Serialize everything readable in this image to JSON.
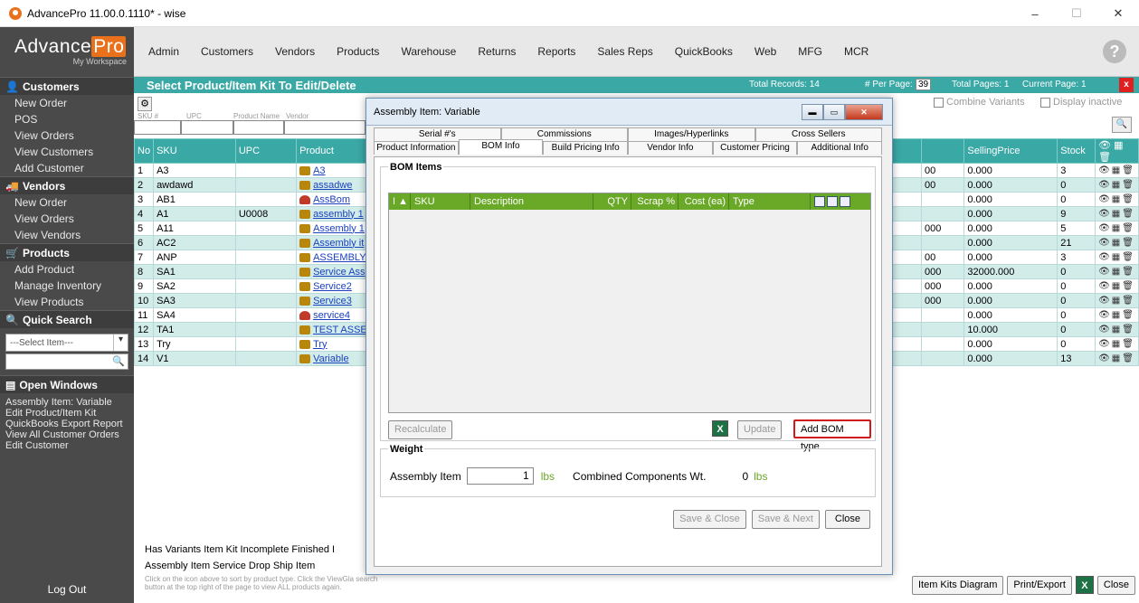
{
  "window": {
    "title": "AdvancePro 11.00.0.1110* - wise",
    "minimize": "–",
    "maximize": "☐",
    "close": "✕"
  },
  "logo": {
    "advance": "Advance",
    "pro": "Pro",
    "sub": "My Workspace"
  },
  "menu": [
    "Admin",
    "Customers",
    "Vendors",
    "Products",
    "Warehouse",
    "Returns",
    "Reports",
    "Sales Reps",
    "QuickBooks",
    "Web",
    "MFG",
    "MCR"
  ],
  "help": "?",
  "sidebar": {
    "customers": {
      "title": "Customers",
      "items": [
        "New Order",
        "POS",
        "View Orders",
        "View Customers",
        "Add Customer"
      ]
    },
    "vendors": {
      "title": "Vendors",
      "items": [
        "New Order",
        "View Orders",
        "View Vendors"
      ]
    },
    "products": {
      "title": "Products",
      "items": [
        "Add Product",
        "Manage Inventory",
        "View Products"
      ]
    },
    "quick_search": {
      "title": "Quick Search",
      "select": "---Select Item---"
    },
    "open_windows": {
      "title": "Open Windows",
      "items": [
        "Assembly Item: Variable",
        "Edit Product/Item Kit",
        "QuickBooks Export Report",
        "View All Customer Orders",
        "Edit Customer"
      ]
    },
    "logout": "Log Out"
  },
  "main": {
    "title": "Select Product/Item Kit To Edit/Delete",
    "total_records": "Total Records: 14",
    "per_page_label": "# Per Page:",
    "per_page": "39",
    "total_pages": "Total Pages: 1",
    "current_page": "Current Page: 1",
    "close": "x",
    "filters": {
      "sku": "SKU #",
      "upc": "UPC",
      "name": "Product Name",
      "vendor": "Vendor"
    },
    "combine_variants": "Combine Variants",
    "display_inactive": "Display inactive",
    "columns": [
      "No",
      "SKU",
      "UPC",
      "Product",
      "SellingPrice",
      "Stock"
    ],
    "rows": [
      {
        "no": "1",
        "sku": "A3",
        "upc": "",
        "product": "A3",
        "c": "00",
        "price": "0.000",
        "stock": "3",
        "type": "assembly"
      },
      {
        "no": "2",
        "sku": "awdawd",
        "upc": "",
        "product": "assadwe",
        "c": "00",
        "price": "0.000",
        "stock": "0",
        "type": "assembly"
      },
      {
        "no": "3",
        "sku": "AB1",
        "upc": "",
        "product": "AssBom",
        "c": "",
        "price": "0.000",
        "stock": "0",
        "type": "incomplete"
      },
      {
        "no": "4",
        "sku": "A1",
        "upc": "U0008",
        "product": "assembly 1",
        "c": "",
        "price": "0.000",
        "stock": "9",
        "type": "assembly"
      },
      {
        "no": "5",
        "sku": "A11",
        "upc": "",
        "product": "Assembly 1",
        "c": "000",
        "price": "0.000",
        "stock": "5",
        "type": "assembly"
      },
      {
        "no": "6",
        "sku": "AC2",
        "upc": "",
        "product": "Assembly it",
        "c": "",
        "price": "0.000",
        "stock": "21",
        "type": "assembly"
      },
      {
        "no": "7",
        "sku": "ANP",
        "upc": "",
        "product": "ASSEMBLY",
        "c": "00",
        "price": "0.000",
        "stock": "3",
        "type": "assembly"
      },
      {
        "no": "8",
        "sku": "SA1",
        "upc": "",
        "product": "Service Ass",
        "c": "000",
        "price": "32000.000",
        "stock": "0",
        "type": "assembly"
      },
      {
        "no": "9",
        "sku": "SA2",
        "upc": "",
        "product": "Service2",
        "c": "000",
        "price": "0.000",
        "stock": "0",
        "type": "assembly"
      },
      {
        "no": "10",
        "sku": "SA3",
        "upc": "",
        "product": "Service3",
        "c": "000",
        "price": "0.000",
        "stock": "0",
        "type": "assembly"
      },
      {
        "no": "11",
        "sku": "SA4",
        "upc": "",
        "product": "service4",
        "c": "",
        "price": "0.000",
        "stock": "0",
        "type": "incomplete"
      },
      {
        "no": "12",
        "sku": "TA1",
        "upc": "",
        "product": "TEST ASSE",
        "c": "",
        "price": "10.000",
        "stock": "0",
        "type": "assembly"
      },
      {
        "no": "13",
        "sku": "Try",
        "upc": "",
        "product": "Try",
        "c": "",
        "price": "0.000",
        "stock": "0",
        "type": "assembly"
      },
      {
        "no": "14",
        "sku": "V1",
        "upc": "",
        "product": "Variable",
        "c": "",
        "price": "0.000",
        "stock": "13",
        "type": "assembly"
      }
    ],
    "legend1": "Has Variants  Item Kit  Incomplete  Finished I",
    "legend2": "Assembly Item  Service  Drop Ship Item",
    "legend3": "Click on the icon above to sort by product type. Click the ViewGla search button at the top right of the page to view ALL products again.",
    "buttons": {
      "kits_diagram": "Item Kits Diagram",
      "print_export": "Print/Export",
      "xls": "X",
      "close": "Close"
    }
  },
  "modal": {
    "title": "Assembly Item: Variable",
    "tabs_row1": [
      "Serial #'s",
      "Commissions",
      "Images/Hyperlinks",
      "Cross Sellers"
    ],
    "tabs_row2": [
      "Product Information",
      "BOM Info",
      "Build Pricing Info",
      "Vendor Info",
      "Customer Pricing",
      "Additional Info"
    ],
    "bom_header": "BOM Items",
    "bom_columns": [
      "I ▲",
      "SKU",
      "Description",
      "QTY",
      "Scrap %",
      "Cost (ea)",
      "Type"
    ],
    "recalculate": "Recalculate",
    "update": "Update",
    "add_bom_type": "Add BOM type",
    "weight_header": "Weight",
    "assembly_item_label": "Assembly Item",
    "assembly_item_value": "1",
    "lbs": "lbs",
    "combined_label": "Combined Components Wt.",
    "combined_value": "0",
    "save_close": "Save & Close",
    "save_next": "Save & Next",
    "close": "Close"
  }
}
